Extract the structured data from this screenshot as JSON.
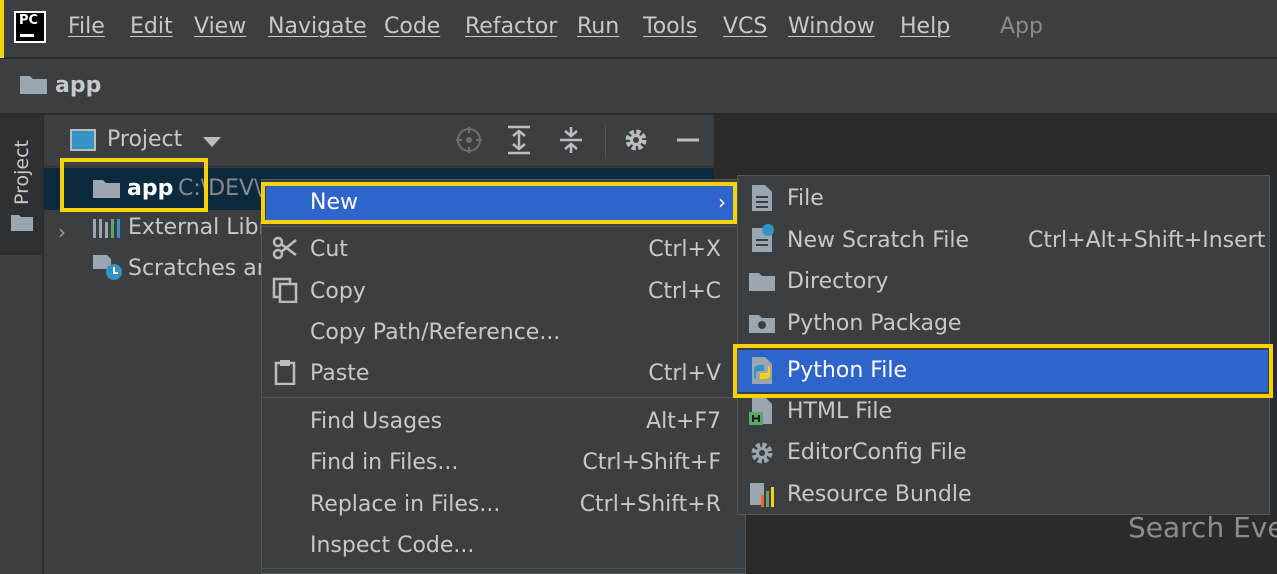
{
  "menubar": {
    "logo_text": "PC",
    "items": [
      "File",
      "Edit",
      "View",
      "Navigate",
      "Code",
      "Refactor",
      "Run",
      "Tools",
      "VCS",
      "Window",
      "Help"
    ],
    "project_title": "App"
  },
  "navbar": {
    "crumb": "app"
  },
  "tool_stripe": {
    "project_tab": "Project"
  },
  "project_panel": {
    "view_label": "Project",
    "tree": {
      "app": {
        "label": "app",
        "path": "C:\\DEV\\"
      },
      "external": {
        "label": "External Libra"
      },
      "scratches": {
        "label": "Scratches an"
      }
    }
  },
  "context_menu": {
    "new": "New",
    "items": [
      {
        "label": "Cut",
        "shortcut": "Ctrl+X"
      },
      {
        "label": "Copy",
        "shortcut": "Ctrl+C"
      },
      {
        "label": "Copy Path/Reference...",
        "shortcut": ""
      },
      {
        "label": "Paste",
        "shortcut": "Ctrl+V"
      },
      {
        "label": "Find Usages",
        "shortcut": "Alt+F7"
      },
      {
        "label": "Find in Files...",
        "shortcut": "Ctrl+Shift+F"
      },
      {
        "label": "Replace in Files...",
        "shortcut": "Ctrl+Shift+R"
      },
      {
        "label": "Inspect Code...",
        "shortcut": ""
      }
    ]
  },
  "submenu": {
    "items": [
      {
        "label": "File",
        "icon": "file-icon"
      },
      {
        "label": "New Scratch File",
        "shortcut": "Ctrl+Alt+Shift+Insert",
        "icon": "scratch-file-icon"
      },
      {
        "label": "Directory",
        "icon": "folder-icon"
      },
      {
        "label": "Python Package",
        "icon": "python-package-icon"
      },
      {
        "label": "Python File",
        "icon": "python-file-icon"
      },
      {
        "label": "HTML File",
        "icon": "html-file-icon"
      },
      {
        "label": "EditorConfig File",
        "icon": "gear-icon"
      },
      {
        "label": "Resource Bundle",
        "icon": "resource-bundle-icon"
      }
    ]
  },
  "editor": {
    "hint": "Search Eve"
  },
  "colors": {
    "highlight": "#f5d20a",
    "selection": "#2f65ca",
    "tree_selection": "#0d293e"
  }
}
